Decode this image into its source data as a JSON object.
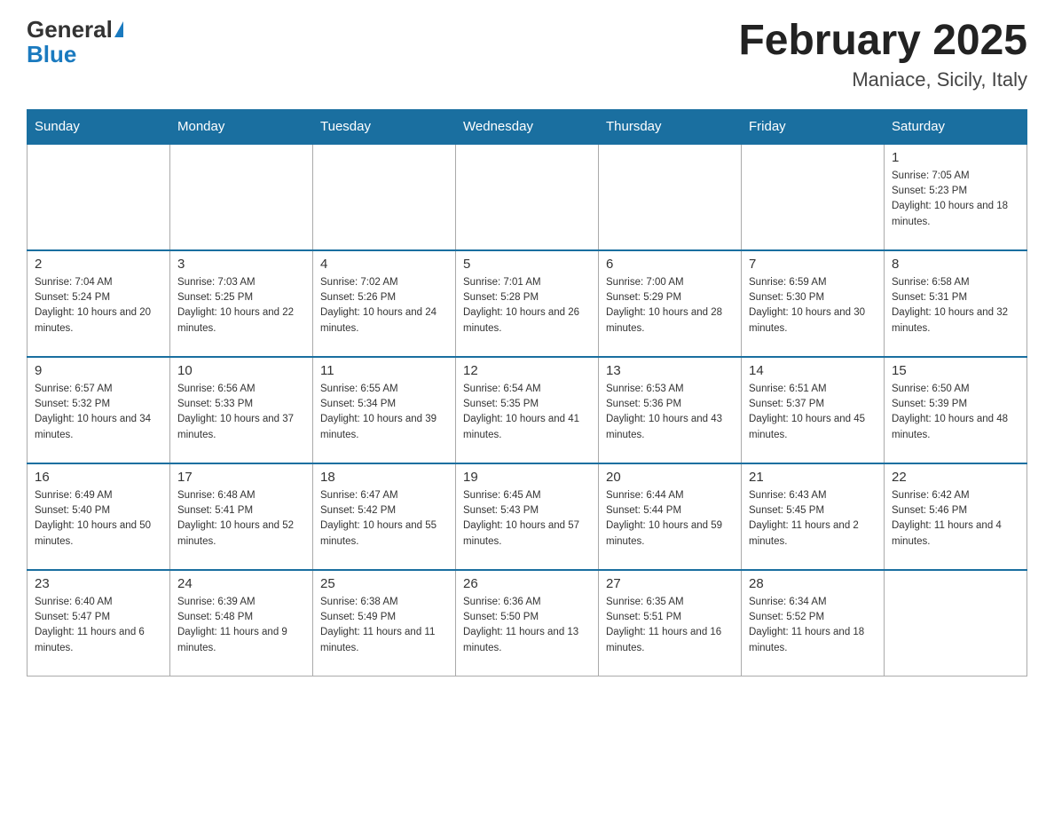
{
  "header": {
    "logo_general": "General",
    "logo_blue": "Blue",
    "month_title": "February 2025",
    "location": "Maniace, Sicily, Italy"
  },
  "days_of_week": [
    "Sunday",
    "Monday",
    "Tuesday",
    "Wednesday",
    "Thursday",
    "Friday",
    "Saturday"
  ],
  "weeks": [
    {
      "days": [
        {
          "num": "",
          "empty": true
        },
        {
          "num": "",
          "empty": true
        },
        {
          "num": "",
          "empty": true
        },
        {
          "num": "",
          "empty": true
        },
        {
          "num": "",
          "empty": true
        },
        {
          "num": "",
          "empty": true
        },
        {
          "num": "1",
          "sunrise": "Sunrise: 7:05 AM",
          "sunset": "Sunset: 5:23 PM",
          "daylight": "Daylight: 10 hours and 18 minutes."
        }
      ]
    },
    {
      "days": [
        {
          "num": "2",
          "sunrise": "Sunrise: 7:04 AM",
          "sunset": "Sunset: 5:24 PM",
          "daylight": "Daylight: 10 hours and 20 minutes."
        },
        {
          "num": "3",
          "sunrise": "Sunrise: 7:03 AM",
          "sunset": "Sunset: 5:25 PM",
          "daylight": "Daylight: 10 hours and 22 minutes."
        },
        {
          "num": "4",
          "sunrise": "Sunrise: 7:02 AM",
          "sunset": "Sunset: 5:26 PM",
          "daylight": "Daylight: 10 hours and 24 minutes."
        },
        {
          "num": "5",
          "sunrise": "Sunrise: 7:01 AM",
          "sunset": "Sunset: 5:28 PM",
          "daylight": "Daylight: 10 hours and 26 minutes."
        },
        {
          "num": "6",
          "sunrise": "Sunrise: 7:00 AM",
          "sunset": "Sunset: 5:29 PM",
          "daylight": "Daylight: 10 hours and 28 minutes."
        },
        {
          "num": "7",
          "sunrise": "Sunrise: 6:59 AM",
          "sunset": "Sunset: 5:30 PM",
          "daylight": "Daylight: 10 hours and 30 minutes."
        },
        {
          "num": "8",
          "sunrise": "Sunrise: 6:58 AM",
          "sunset": "Sunset: 5:31 PM",
          "daylight": "Daylight: 10 hours and 32 minutes."
        }
      ]
    },
    {
      "days": [
        {
          "num": "9",
          "sunrise": "Sunrise: 6:57 AM",
          "sunset": "Sunset: 5:32 PM",
          "daylight": "Daylight: 10 hours and 34 minutes."
        },
        {
          "num": "10",
          "sunrise": "Sunrise: 6:56 AM",
          "sunset": "Sunset: 5:33 PM",
          "daylight": "Daylight: 10 hours and 37 minutes."
        },
        {
          "num": "11",
          "sunrise": "Sunrise: 6:55 AM",
          "sunset": "Sunset: 5:34 PM",
          "daylight": "Daylight: 10 hours and 39 minutes."
        },
        {
          "num": "12",
          "sunrise": "Sunrise: 6:54 AM",
          "sunset": "Sunset: 5:35 PM",
          "daylight": "Daylight: 10 hours and 41 minutes."
        },
        {
          "num": "13",
          "sunrise": "Sunrise: 6:53 AM",
          "sunset": "Sunset: 5:36 PM",
          "daylight": "Daylight: 10 hours and 43 minutes."
        },
        {
          "num": "14",
          "sunrise": "Sunrise: 6:51 AM",
          "sunset": "Sunset: 5:37 PM",
          "daylight": "Daylight: 10 hours and 45 minutes."
        },
        {
          "num": "15",
          "sunrise": "Sunrise: 6:50 AM",
          "sunset": "Sunset: 5:39 PM",
          "daylight": "Daylight: 10 hours and 48 minutes."
        }
      ]
    },
    {
      "days": [
        {
          "num": "16",
          "sunrise": "Sunrise: 6:49 AM",
          "sunset": "Sunset: 5:40 PM",
          "daylight": "Daylight: 10 hours and 50 minutes."
        },
        {
          "num": "17",
          "sunrise": "Sunrise: 6:48 AM",
          "sunset": "Sunset: 5:41 PM",
          "daylight": "Daylight: 10 hours and 52 minutes."
        },
        {
          "num": "18",
          "sunrise": "Sunrise: 6:47 AM",
          "sunset": "Sunset: 5:42 PM",
          "daylight": "Daylight: 10 hours and 55 minutes."
        },
        {
          "num": "19",
          "sunrise": "Sunrise: 6:45 AM",
          "sunset": "Sunset: 5:43 PM",
          "daylight": "Daylight: 10 hours and 57 minutes."
        },
        {
          "num": "20",
          "sunrise": "Sunrise: 6:44 AM",
          "sunset": "Sunset: 5:44 PM",
          "daylight": "Daylight: 10 hours and 59 minutes."
        },
        {
          "num": "21",
          "sunrise": "Sunrise: 6:43 AM",
          "sunset": "Sunset: 5:45 PM",
          "daylight": "Daylight: 11 hours and 2 minutes."
        },
        {
          "num": "22",
          "sunrise": "Sunrise: 6:42 AM",
          "sunset": "Sunset: 5:46 PM",
          "daylight": "Daylight: 11 hours and 4 minutes."
        }
      ]
    },
    {
      "days": [
        {
          "num": "23",
          "sunrise": "Sunrise: 6:40 AM",
          "sunset": "Sunset: 5:47 PM",
          "daylight": "Daylight: 11 hours and 6 minutes."
        },
        {
          "num": "24",
          "sunrise": "Sunrise: 6:39 AM",
          "sunset": "Sunset: 5:48 PM",
          "daylight": "Daylight: 11 hours and 9 minutes."
        },
        {
          "num": "25",
          "sunrise": "Sunrise: 6:38 AM",
          "sunset": "Sunset: 5:49 PM",
          "daylight": "Daylight: 11 hours and 11 minutes."
        },
        {
          "num": "26",
          "sunrise": "Sunrise: 6:36 AM",
          "sunset": "Sunset: 5:50 PM",
          "daylight": "Daylight: 11 hours and 13 minutes."
        },
        {
          "num": "27",
          "sunrise": "Sunrise: 6:35 AM",
          "sunset": "Sunset: 5:51 PM",
          "daylight": "Daylight: 11 hours and 16 minutes."
        },
        {
          "num": "28",
          "sunrise": "Sunrise: 6:34 AM",
          "sunset": "Sunset: 5:52 PM",
          "daylight": "Daylight: 11 hours and 18 minutes."
        },
        {
          "num": "",
          "empty": true
        }
      ]
    }
  ]
}
